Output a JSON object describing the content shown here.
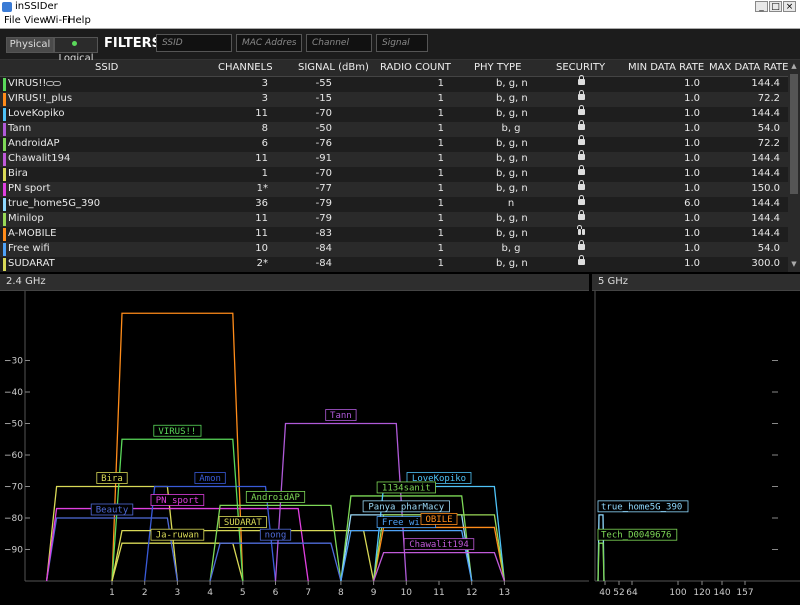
{
  "window": {
    "title": "inSSIDer",
    "min_glyph": "_",
    "max_glyph": "□",
    "close_glyph": "×"
  },
  "menu": [
    "File",
    "View",
    "Wi-Fi",
    "Help"
  ],
  "toolbar": {
    "physical_label": "Physical",
    "logical_label": "Logical",
    "filters_label": "FILTERS:"
  },
  "filters": {
    "ssid_placeholder": "SSID",
    "mac_placeholder": "MAC Address",
    "channel_placeholder": "Channel",
    "signal_placeholder": "Signal"
  },
  "grid": {
    "columns": [
      "SSID",
      "CHANNELS",
      "SIGNAL (dBm)",
      "RADIO COUNT",
      "PHY TYPE",
      "SECURITY",
      "MIN DATA RATE",
      "MAX DATA RATE"
    ],
    "rows": [
      {
        "ssid": "VIRUS!!",
        "channels": "3",
        "signal": "-55",
        "radio_count": "1",
        "phy": "b, g, n",
        "security": "lock",
        "min_rate": "1.0",
        "max_rate": "144.4",
        "color": "#5ad95a",
        "linked": true
      },
      {
        "ssid": "VIRUS!!_plus",
        "channels": "3",
        "signal": "-15",
        "radio_count": "1",
        "phy": "b, g, n",
        "security": "lock",
        "min_rate": "1.0",
        "max_rate": "72.2",
        "color": "#ff8c1a"
      },
      {
        "ssid": "LoveKopiko",
        "channels": "11",
        "signal": "-70",
        "radio_count": "1",
        "phy": "b, g, n",
        "security": "lock",
        "min_rate": "1.0",
        "max_rate": "144.4",
        "color": "#4fc3f7"
      },
      {
        "ssid": "Tann",
        "channels": "8",
        "signal": "-50",
        "radio_count": "1",
        "phy": "b, g",
        "security": "lock",
        "min_rate": "1.0",
        "max_rate": "54.0",
        "color": "#b05ad9"
      },
      {
        "ssid": "AndroidAP",
        "channels": "6",
        "signal": "-76",
        "radio_count": "1",
        "phy": "b, g, n",
        "security": "lock",
        "min_rate": "1.0",
        "max_rate": "72.2",
        "color": "#7ed957"
      },
      {
        "ssid": "Chawalit194",
        "channels": "11",
        "signal": "-91",
        "radio_count": "1",
        "phy": "b, g, n",
        "security": "lock",
        "min_rate": "1.0",
        "max_rate": "144.4",
        "color": "#c05ad9"
      },
      {
        "ssid": "Bira",
        "channels": "1",
        "signal": "-70",
        "radio_count": "1",
        "phy": "b, g, n",
        "security": "lock",
        "min_rate": "1.0",
        "max_rate": "144.4",
        "color": "#d9d957"
      },
      {
        "ssid": "PN sport",
        "channels": "1*",
        "signal": "-77",
        "radio_count": "1",
        "phy": "b, g, n",
        "security": "lock",
        "min_rate": "1.0",
        "max_rate": "150.0",
        "color": "#e040e0"
      },
      {
        "ssid": "true_home5G_390",
        "channels": "36",
        "signal": "-79",
        "radio_count": "1",
        "phy": "n",
        "security": "lock",
        "min_rate": "6.0",
        "max_rate": "144.4",
        "color": "#8fd9ff"
      },
      {
        "ssid": "Minilop",
        "channels": "11",
        "signal": "-79",
        "radio_count": "1",
        "phy": "b, g, n",
        "security": "lock",
        "min_rate": "1.0",
        "max_rate": "144.4",
        "color": "#9ad957"
      },
      {
        "ssid": "A-MOBILE",
        "channels": "11",
        "signal": "-83",
        "radio_count": "1",
        "phy": "b, g, n",
        "security": "unlock",
        "min_rate": "1.0",
        "max_rate": "144.4",
        "color": "#ff8c1a"
      },
      {
        "ssid": "Free wifi",
        "channels": "10",
        "signal": "-84",
        "radio_count": "1",
        "phy": "b, g",
        "security": "lock",
        "min_rate": "1.0",
        "max_rate": "54.0",
        "color": "#4fa3f7"
      },
      {
        "ssid": "SUDARAT",
        "channels": "2*",
        "signal": "-84",
        "radio_count": "1",
        "phy": "b, g, n",
        "security": "lock",
        "min_rate": "1.0",
        "max_rate": "300.0",
        "color": "#d9d957"
      }
    ]
  },
  "chart_data": [
    {
      "type": "area",
      "title": "2.4 GHz",
      "xlabel": "",
      "ylabel": "",
      "xlim": [
        -1,
        15
      ],
      "ylim": [
        -100,
        -20
      ],
      "x_ticks": [
        1,
        2,
        3,
        4,
        5,
        6,
        7,
        8,
        9,
        10,
        11,
        12,
        13
      ],
      "y_ticks": [
        -30,
        -40,
        -50,
        -60,
        -70,
        -80,
        -90
      ],
      "series": [
        {
          "name": "VIRUS!!_plus",
          "center": 3,
          "width": 4,
          "signal": -15,
          "color": "#ff8c1a"
        },
        {
          "name": "Ja-ruwan",
          "center": 3,
          "width": 4,
          "signal": -88,
          "color": "#d9d957"
        },
        {
          "name": "Bira",
          "center": 1,
          "width": 4,
          "signal": -70,
          "color": "#d9d957"
        },
        {
          "name": "Beauty",
          "center": 1,
          "width": 4,
          "signal": -80,
          "color": "#4f6bd9"
        },
        {
          "name": "PN sport",
          "center": 3,
          "width": 8,
          "signal": -77,
          "color": "#e040e0"
        },
        {
          "name": "Amon",
          "center": 4,
          "width": 4,
          "signal": -70,
          "color": "#3a5bd9"
        },
        {
          "name": "VIRUS!!",
          "center": 3,
          "width": 4,
          "signal": -55,
          "color": "#5ad95a"
        },
        {
          "name": "SUDARAT",
          "center": 5,
          "width": 8,
          "signal": -84,
          "color": "#d9d957"
        },
        {
          "name": "AndroidAP",
          "center": 6,
          "width": 4,
          "signal": -76,
          "color": "#7ed957"
        },
        {
          "name": "nong",
          "center": 6,
          "width": 4,
          "signal": -88,
          "color": "#4f6bd9"
        },
        {
          "name": "Tann",
          "center": 8,
          "width": 4,
          "signal": -50,
          "color": "#b05ad9"
        },
        {
          "name": "1134sanit",
          "center": 10,
          "width": 4,
          "signal": -73,
          "color": "#7ed957"
        },
        {
          "name": "LoveKopiko",
          "center": 11,
          "width": 4,
          "signal": -70,
          "color": "#4fc3f7"
        },
        {
          "name": "Panya pharMacy",
          "center": 10,
          "width": 4,
          "signal": -79,
          "color": "#9ad9f7"
        },
        {
          "name": "Free wifi",
          "center": 10,
          "width": 4,
          "signal": -84,
          "color": "#4fa3f7"
        },
        {
          "name": "A-MOBILE",
          "center": 11,
          "width": 4,
          "signal": -83,
          "color": "#ff8c1a"
        },
        {
          "name": "Minilop",
          "center": 11,
          "width": 4,
          "signal": -79,
          "color": "#9ad957"
        },
        {
          "name": "Chawalit194",
          "center": 11,
          "width": 4,
          "signal": -91,
          "color": "#c05ad9"
        }
      ],
      "labels": [
        {
          "text": "VIRUS!!",
          "series": "VIRUS!!"
        },
        {
          "text": "Tann",
          "series": "Tann"
        },
        {
          "text": "Bira",
          "series": "Bira"
        },
        {
          "text": "Amon",
          "series": "Amon"
        },
        {
          "text": "LoveKopiko",
          "series": "LoveKopiko"
        },
        {
          "text": "1134sanit",
          "series": "1134sanit"
        },
        {
          "text": "AndroidAP",
          "series": "AndroidAP"
        },
        {
          "text": "PN sport",
          "series": "PN sport"
        },
        {
          "text": "Beauty",
          "series": "Beauty"
        },
        {
          "text": "Panya pharMacy",
          "series": "Panya pharMacy"
        },
        {
          "text": "SUDARAT",
          "series": "SUDARAT"
        },
        {
          "text": "Free wifi",
          "series": "Free wifi"
        },
        {
          "text": "OBILE",
          "series": "A-MOBILE"
        },
        {
          "text": "Ja-ruwan",
          "series": "Ja-ruwan"
        },
        {
          "text": "nong",
          "series": "nong"
        },
        {
          "text": "Chawalit194",
          "series": "Chawalit194"
        }
      ]
    },
    {
      "type": "area",
      "title": "5 GHz",
      "xlabel": "",
      "ylabel": "",
      "ylim": [
        -100,
        -20
      ],
      "x_ticks": [
        "40",
        "52",
        "64",
        "100",
        "120",
        "140",
        "157"
      ],
      "series": [
        {
          "name": "true_home5G_390",
          "channel": 36,
          "signal": -79,
          "color": "#8fd9ff"
        },
        {
          "name": "Tech_D0049676",
          "channel": 36,
          "signal": -88,
          "color": "#7ed957"
        }
      ],
      "labels": [
        {
          "text": "true_home5G_390",
          "series": "true_home5G_390"
        },
        {
          "text": "Tech_D0049676",
          "series": "Tech_D0049676"
        }
      ]
    }
  ]
}
